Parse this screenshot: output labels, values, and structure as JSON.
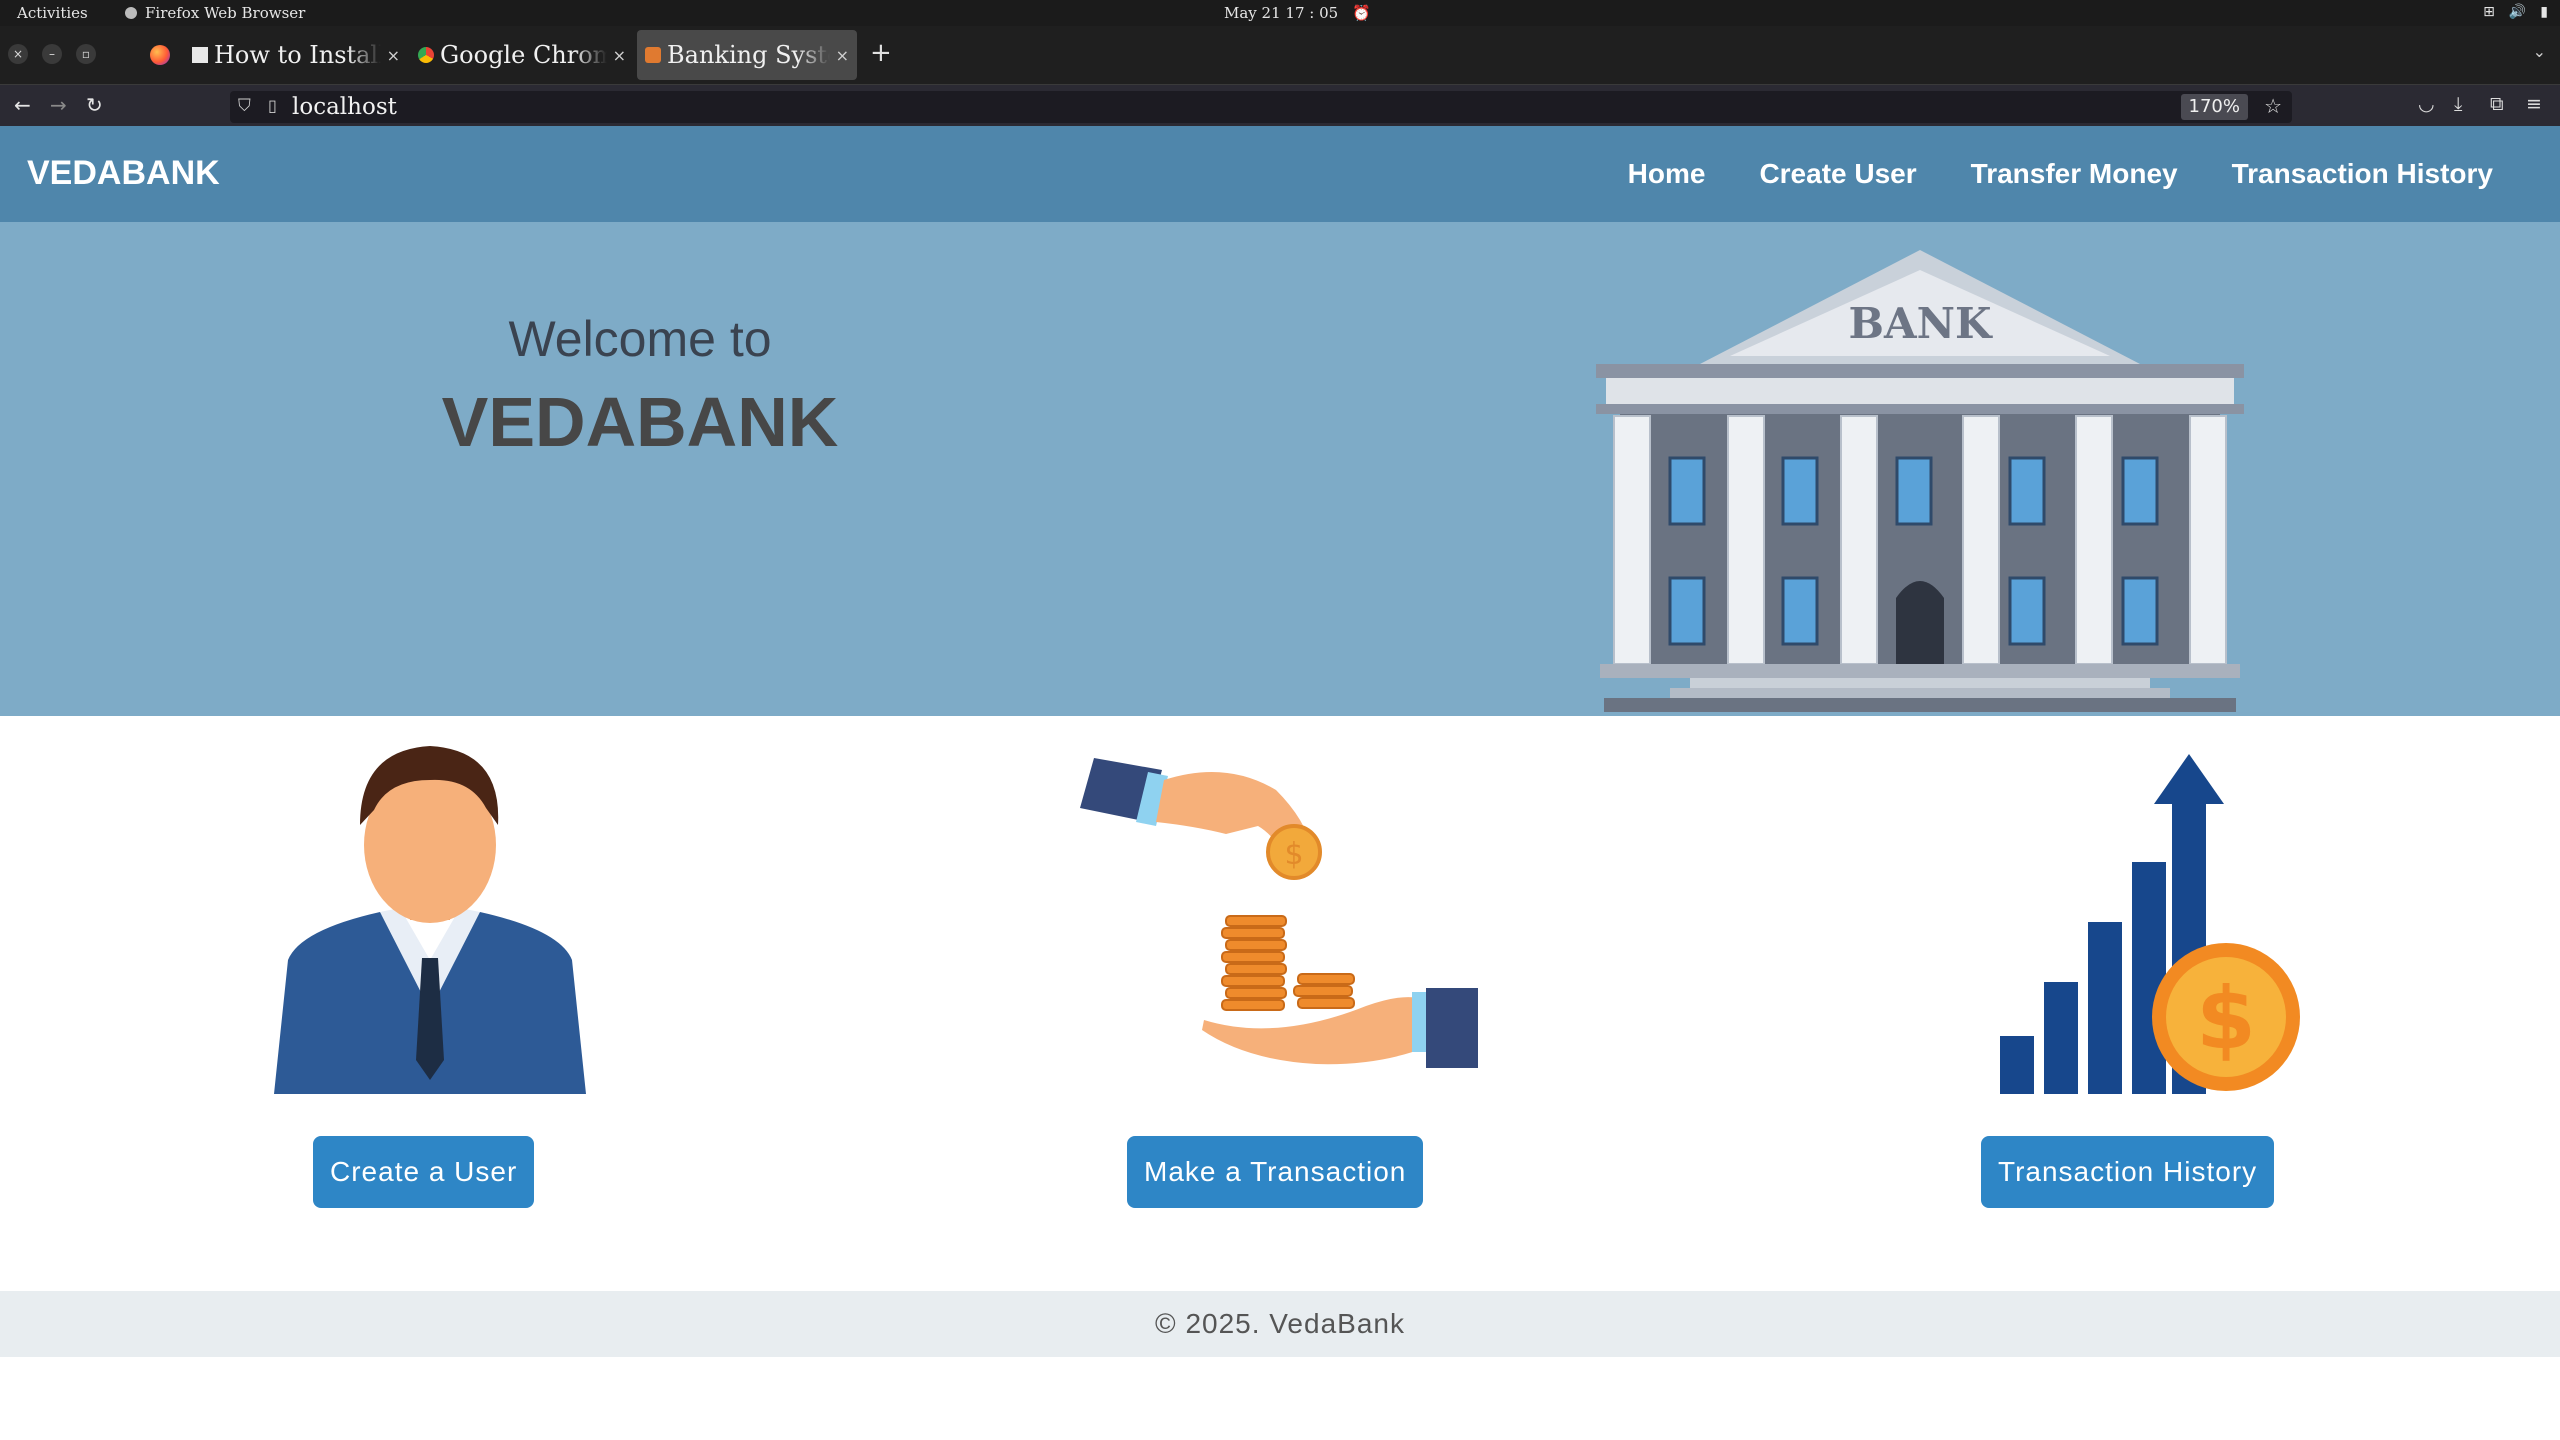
{
  "system": {
    "activities": "Activities",
    "app_name": "Firefox Web Browser",
    "clock": "May 21  17 : 05"
  },
  "browser": {
    "tabs": [
      {
        "title": "How to Install (",
        "active": false
      },
      {
        "title": "Google Chrome",
        "active": false
      },
      {
        "title": "Banking System",
        "active": true
      }
    ],
    "url": "localhost",
    "zoom": "170%"
  },
  "site": {
    "brand": "VEDABANK",
    "nav": [
      "Home",
      "Create User",
      "Transfer Money",
      "Transaction History"
    ],
    "hero": {
      "welcome": "Welcome to",
      "title": "VEDABANK",
      "bank_sign": "BANK"
    },
    "features": [
      {
        "button": "Create a User",
        "icon": "business-person-icon"
      },
      {
        "button": "Make a Transaction",
        "icon": "coin-transfer-icon"
      },
      {
        "button": "Transaction History",
        "icon": "growth-chart-icon"
      }
    ],
    "footer": "© 2025. VedaBank"
  },
  "colors": {
    "header": "#4f86ab",
    "hero": "#7eabc7",
    "button": "#2e86c6",
    "footer": "#e8edf0"
  }
}
